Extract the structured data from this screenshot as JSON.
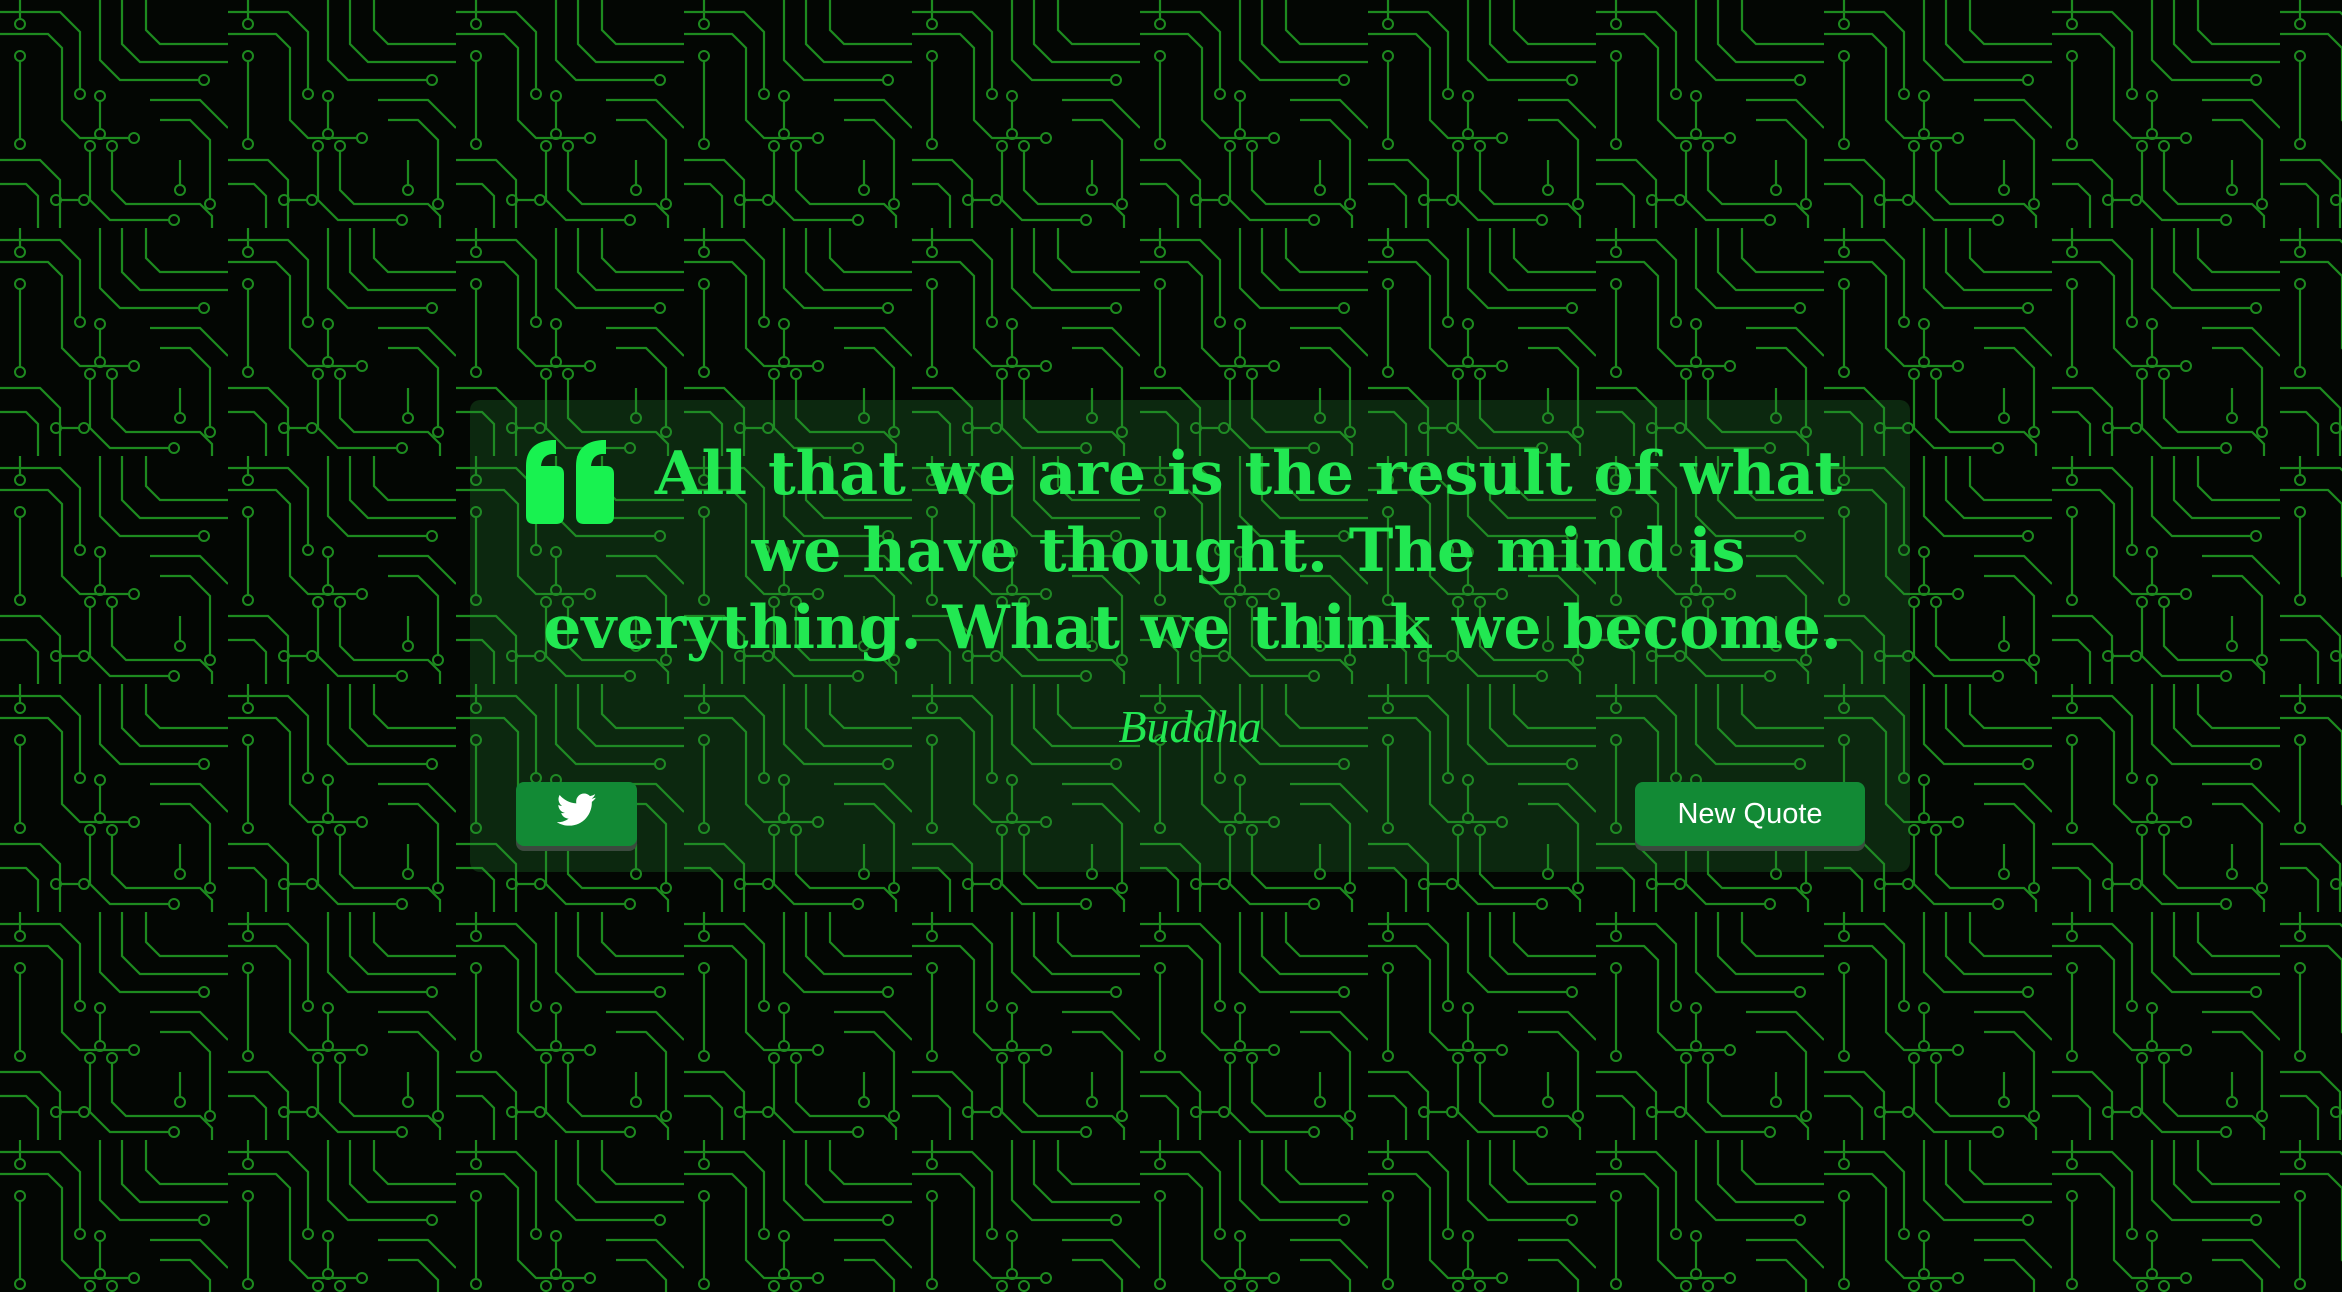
{
  "quote": {
    "text": "All that we are is the result of what we have thought. The mind is everything. What we think we become.",
    "author": "Buddha",
    "icon": "quote-left-icon"
  },
  "buttons": {
    "tweet_icon": "twitter-icon",
    "new_quote_label": "New Quote"
  },
  "colors": {
    "accent": "#22e852",
    "button": "#128a35",
    "background": "#030603",
    "circuit": "#1f8f1f"
  }
}
